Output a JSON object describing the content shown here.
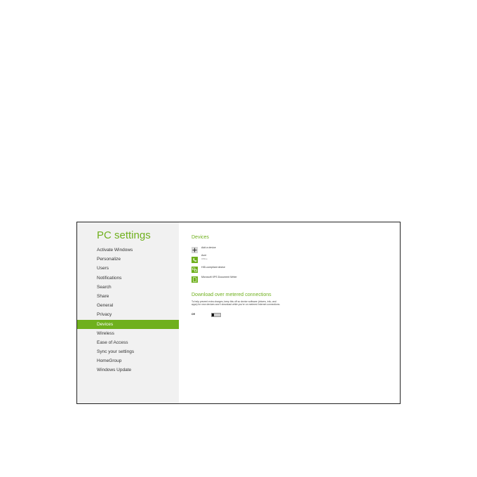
{
  "window": {
    "title": "PC settings"
  },
  "sidebar": {
    "items": [
      {
        "label": "Activate Windows"
      },
      {
        "label": "Personalize"
      },
      {
        "label": "Users"
      },
      {
        "label": "Notifications"
      },
      {
        "label": "Search"
      },
      {
        "label": "Share"
      },
      {
        "label": "General"
      },
      {
        "label": "Privacy"
      },
      {
        "label": "Devices",
        "active": true
      },
      {
        "label": "Wireless"
      },
      {
        "label": "Ease of Access"
      },
      {
        "label": "Sync your settings"
      },
      {
        "label": "HomeGroup"
      },
      {
        "label": "Windows Update"
      }
    ]
  },
  "devices": {
    "title": "Devices",
    "items": [
      {
        "label": "Add a device",
        "sub": "",
        "icon": "plus-icon"
      },
      {
        "label": "Acer",
        "sub": "Offline",
        "icon": "phone-icon"
      },
      {
        "label": "HID-compliant device",
        "sub": "",
        "icon": "hid-device-icon"
      },
      {
        "label": "Microsoft XPS Document Writer",
        "sub": "",
        "icon": "printer-document-icon"
      }
    ]
  },
  "metered": {
    "title": "Download over metered connections",
    "description": "To help prevent extra charges, keep this off so device software (drivers, info, and apps) for new devices won't download while you're on metered Internet connections.",
    "state": "Off",
    "toggle_on": false
  },
  "colors": {
    "accent": "#6fb01d",
    "sidebar_bg": "#f1f1f1"
  }
}
